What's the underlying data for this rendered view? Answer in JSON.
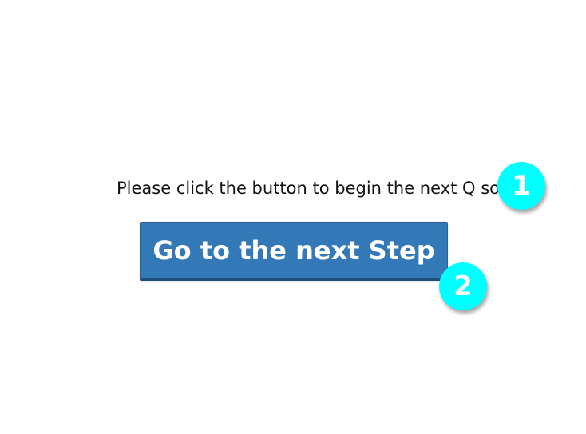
{
  "instruction": {
    "text": "Please click the button to begin the next Q sort"
  },
  "next_button": {
    "label": "Go to the next Step",
    "color": "#3479b7"
  },
  "markers": [
    {
      "label": "1",
      "color": "#00ffff"
    },
    {
      "label": "2",
      "color": "#00ffff"
    }
  ]
}
